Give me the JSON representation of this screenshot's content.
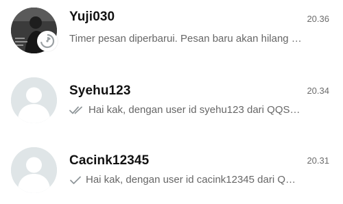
{
  "chats": [
    {
      "name": "Yuji030",
      "time": "20.36",
      "preview": "Timer pesan diperbarui. Pesan baru akan hilang …",
      "avatar": "photo",
      "badge_icon": "disappearing-timer-icon"
    },
    {
      "name": "Syehu123",
      "time": "20.34",
      "preview": "Hai kak, dengan user id syehu123 dari QQS…",
      "avatar": "default",
      "status_icon": "double-check-icon"
    },
    {
      "name": "Cacink12345",
      "time": "20.31",
      "preview": "Hai kak, dengan user id cacink12345 dari Q…",
      "avatar": "default",
      "status_icon": "single-check-icon"
    }
  ],
  "colors": {
    "default_avatar_bg": "#dfe5e7",
    "default_avatar_fg": "#ffffff",
    "check_color": "#8f9699",
    "time_color": "#6b6b6b",
    "preview_color": "#666666"
  }
}
